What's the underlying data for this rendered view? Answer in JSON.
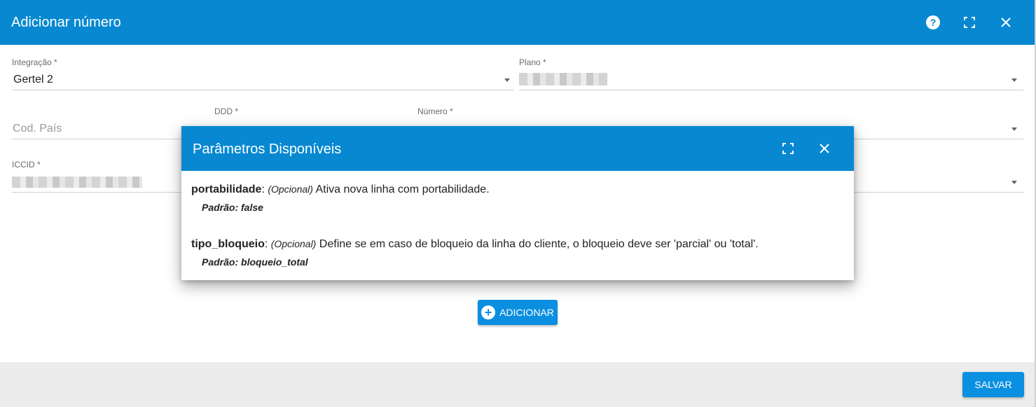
{
  "window": {
    "title": "Adicionar número"
  },
  "form": {
    "integracao": {
      "label": "Integração *",
      "value": "Gertel 2"
    },
    "plano": {
      "label": "Plano *"
    },
    "cod_pais": {
      "placeholder": "Cod. País"
    },
    "ddd": {
      "label": "DDD *"
    },
    "numero": {
      "label": "Número *"
    },
    "iccid": {
      "label": "ICCID *"
    }
  },
  "add_button": {
    "label": "ADICIONAR"
  },
  "save_button": {
    "label": "SALVAR"
  },
  "modal": {
    "title": "Parâmetros Disponíveis",
    "params": [
      {
        "name": "portabilidade",
        "sep": ": ",
        "optional": "(Opcional)",
        "description": " Ativa nova linha com portabilidade.",
        "default": "Padrão: false"
      },
      {
        "name": "tipo_bloqueio",
        "sep": ": ",
        "optional": "(Opcional)",
        "description": " Define se em caso de bloqueio da linha do cliente, o bloqueio deve ser 'parcial' ou 'total'.",
        "default": "Padrão: bloqueio_total"
      }
    ]
  },
  "icons": [
    "help-icon",
    "fullscreen-icon",
    "close-icon",
    "dropdown-arrow-icon",
    "add-circle-icon"
  ],
  "colors": {
    "header": "#0788d1",
    "button": "#0b8fe0",
    "footer": "#ececec"
  }
}
